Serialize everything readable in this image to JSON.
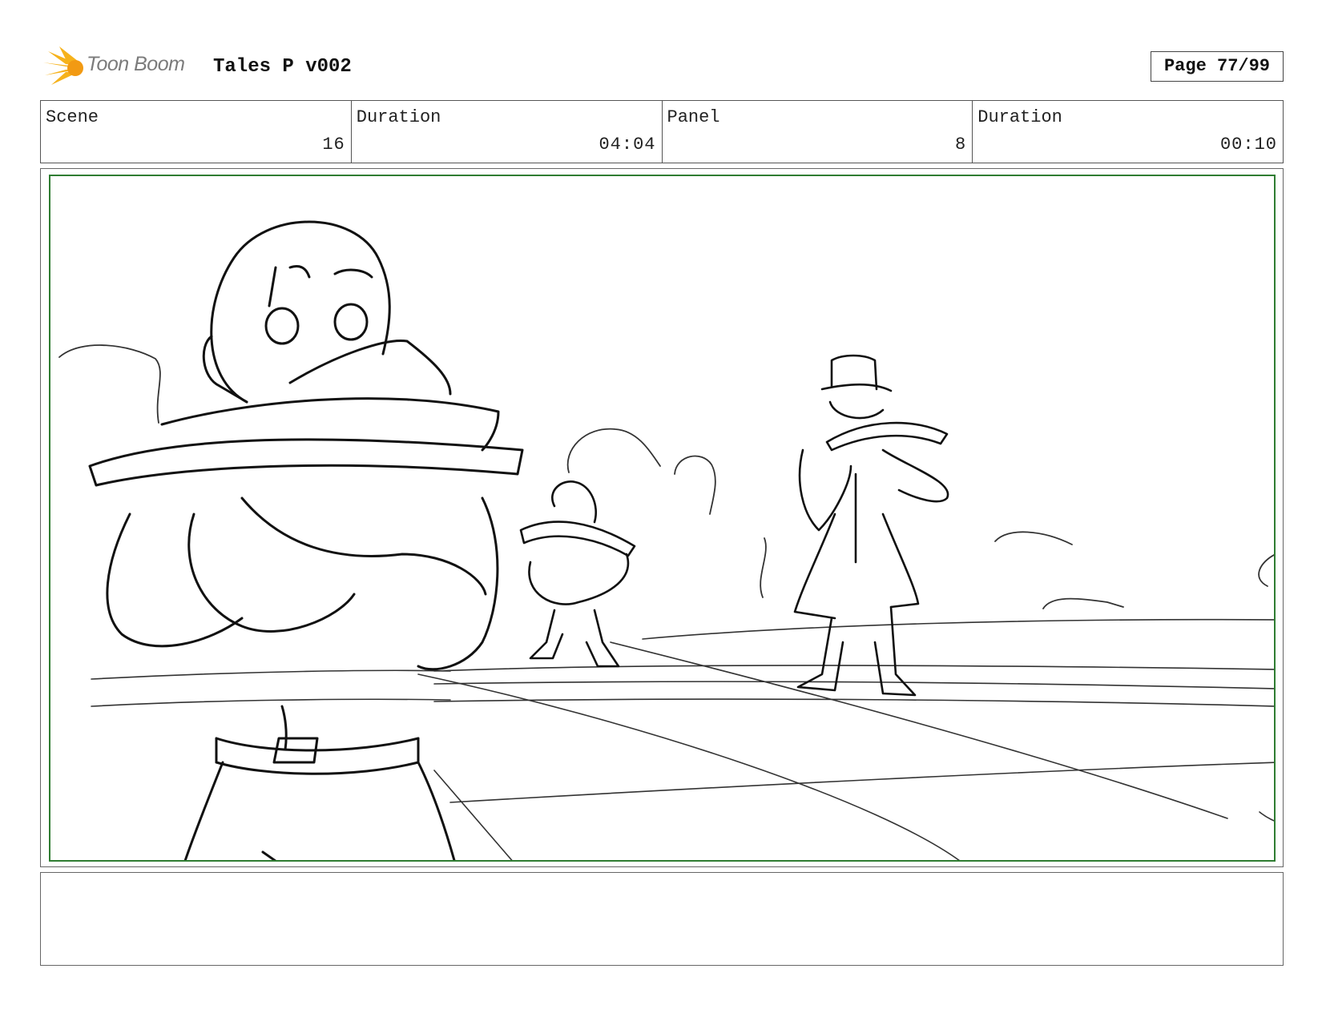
{
  "header": {
    "logo_text": "Toon Boom",
    "title": "Tales P v002",
    "page": "Page 77/99"
  },
  "info": {
    "scene_label": "Scene",
    "scene_value": "16",
    "duration_label": "Duration",
    "duration_value": "04:04",
    "panel_label": "Panel",
    "panel_value": "8",
    "panel_duration_label": "Duration",
    "panel_duration_value": "00:10"
  },
  "notes": {
    "text": ""
  },
  "colors": {
    "safe_area_border": "#2f7d32",
    "logo_burst": "#f6b21b",
    "ink": "#111111"
  }
}
